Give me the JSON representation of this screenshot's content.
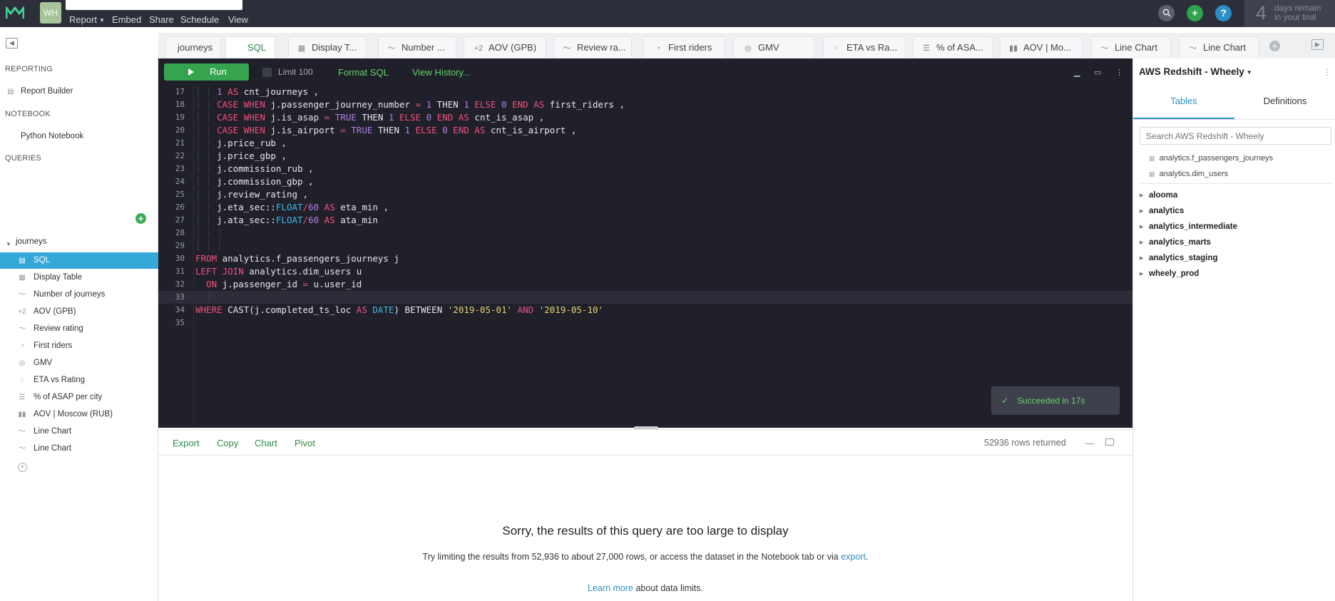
{
  "topbar": {
    "avatar_initials": "WH",
    "menu": [
      "Report",
      "Embed",
      "Share",
      "Schedule",
      "View"
    ],
    "trial_days": "4",
    "trial_line1": "days remain",
    "trial_line2": "in your trial",
    "colors": {
      "bg": "#2c2e3a",
      "add": "#2ea44f",
      "help": "#2a8fc4"
    }
  },
  "tabs": [
    {
      "label": "journeys",
      "icon": ""
    },
    {
      "label": "SQL",
      "icon": ""
    },
    {
      "label": "Display T...",
      "icon": "table-icon"
    },
    {
      "label": "Number ...",
      "icon": "line-chart-icon"
    },
    {
      "label": "AOV (GPB)",
      "icon": "plus-two-icon"
    },
    {
      "label": "Review ra...",
      "icon": "line-chart-icon"
    },
    {
      "label": "First riders",
      "icon": "pie-icon"
    },
    {
      "label": "GMV",
      "icon": "gauge-icon"
    },
    {
      "label": "ETA vs Ra...",
      "icon": "scatter-icon"
    },
    {
      "label": "% of ASA...",
      "icon": "list-icon"
    },
    {
      "label": "AOV | Mo...",
      "icon": "bar-chart-icon"
    },
    {
      "label": "Line Chart",
      "icon": "line-chart-icon"
    },
    {
      "label": "Line Chart",
      "icon": "line-chart-icon"
    }
  ],
  "sidebar": {
    "reporting_header": "REPORTING",
    "report_builder": "Report Builder",
    "notebook_header": "NOTEBOOK",
    "python_notebook": "Python Notebook",
    "queries_header": "QUERIES",
    "folder": "journeys",
    "queries": [
      {
        "label": "SQL",
        "icon": "sql-icon"
      },
      {
        "label": "Display Table",
        "icon": "table-icon"
      },
      {
        "label": "Number of journeys",
        "icon": "line-chart-icon"
      },
      {
        "label": "AOV (GPB)",
        "icon": "plus-two-icon"
      },
      {
        "label": "Review rating",
        "icon": "line-chart-icon"
      },
      {
        "label": "First riders",
        "icon": "pie-icon"
      },
      {
        "label": "GMV",
        "icon": "gauge-icon"
      },
      {
        "label": "ETA vs Rating",
        "icon": "scatter-icon"
      },
      {
        "label": "% of ASAP per city",
        "icon": "list-icon"
      },
      {
        "label": "AOV | Moscow (RUB)",
        "icon": "bar-chart-icon"
      },
      {
        "label": "Line Chart",
        "icon": "line-chart-icon"
      },
      {
        "label": "Line Chart",
        "icon": "line-chart-icon"
      }
    ]
  },
  "editor_toolbar": {
    "run_label": "Run",
    "limit_label": "Limit 100",
    "format_label": "Format SQL",
    "history_label": "View History..."
  },
  "code": [
    {
      "n": "17",
      "t": "1 AS cnt_journeys ,"
    },
    {
      "n": "18",
      "t": "CASE WHEN j.passenger_journey_number = 1 THEN 1 ELSE 0 END AS first_riders ,"
    },
    {
      "n": "19",
      "t": "CASE WHEN j.is_asap = TRUE THEN 1 ELSE 0 END AS cnt_is_asap ,"
    },
    {
      "n": "20",
      "t": "CASE WHEN j.is_airport = TRUE THEN 1 ELSE 0 END AS cnt_is_airport ,"
    },
    {
      "n": "21",
      "t": "j.price_rub ,"
    },
    {
      "n": "22",
      "t": "j.price_gbp ,"
    },
    {
      "n": "23",
      "t": "j.commission_rub ,"
    },
    {
      "n": "24",
      "t": "j.commission_gbp ,"
    },
    {
      "n": "25",
      "t": "j.review_rating ,"
    },
    {
      "n": "26",
      "t": "j.eta_sec::FLOAT/60 AS eta_min ,"
    },
    {
      "n": "27",
      "t": "j.ata_sec::FLOAT/60 AS ata_min"
    },
    {
      "n": "28",
      "t": ""
    },
    {
      "n": "29",
      "t": ""
    },
    {
      "n": "30",
      "t": "FROM analytics.f_passengers_journeys j"
    },
    {
      "n": "31",
      "t": "LEFT JOIN analytics.dim_users u"
    },
    {
      "n": "32",
      "t": "ON j.passenger_id = u.user_id"
    },
    {
      "n": "33",
      "t": ""
    },
    {
      "n": "34",
      "t": "WHERE CAST(j.completed_ts_loc AS DATE) BETWEEN '2019-05-01' AND '2019-05-10'"
    },
    {
      "n": "35",
      "t": ""
    }
  ],
  "toast": "Succeeded in 17s",
  "results": {
    "actions": [
      "Export",
      "Copy",
      "Chart",
      "Pivot"
    ],
    "rows_returned": "52936 rows returned",
    "title": "Sorry, the results of this query are too large to display",
    "hint_before": "Try limiting the results from 52,936 to about 27,000 rows, or access the dataset in the Notebook tab or via ",
    "hint_link": "export",
    "hint_after": ".",
    "learn_link": "Learn more",
    "learn_after": " about data limits."
  },
  "schema_panel": {
    "database": "AWS Redshift - Wheely",
    "tab_tables": "Tables",
    "tab_definitions": "Definitions",
    "search_placeholder": "Search AWS Redshift - Wheely",
    "tables": [
      "analytics.f_passengers_journeys",
      "analytics.dim_users"
    ],
    "schemas": [
      "alooma",
      "analytics",
      "analytics_intermediate",
      "analytics_marts",
      "analytics_staging",
      "wheely_prod"
    ]
  }
}
